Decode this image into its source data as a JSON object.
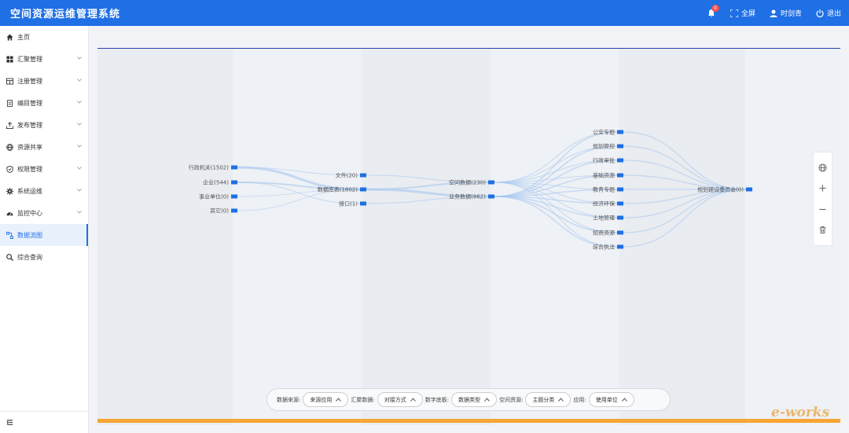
{
  "header": {
    "title": "空间资源运维管理系统",
    "notification_count": "0",
    "fullscreen_label": "全屏",
    "user_name": "时剑青",
    "logout_label": "退出"
  },
  "sidebar": {
    "items": [
      {
        "label": "主页",
        "icon": "home-icon",
        "has_chevron": false
      },
      {
        "label": "汇聚管理",
        "icon": "grid-icon",
        "has_chevron": true
      },
      {
        "label": "注册管理",
        "icon": "register-icon",
        "has_chevron": true
      },
      {
        "label": "编目管理",
        "icon": "catalog-icon",
        "has_chevron": true
      },
      {
        "label": "发布管理",
        "icon": "upload-icon",
        "has_chevron": true
      },
      {
        "label": "资源共享",
        "icon": "globe-icon",
        "has_chevron": true
      },
      {
        "label": "权限管理",
        "icon": "shield-icon",
        "has_chevron": true
      },
      {
        "label": "系统运维",
        "icon": "gear-icon",
        "has_chevron": true
      },
      {
        "label": "监控中心",
        "icon": "monitor-icon",
        "has_chevron": true
      },
      {
        "label": "数据流图",
        "icon": "flow-icon",
        "has_chevron": false,
        "active": true
      },
      {
        "label": "综合查询",
        "icon": "search-icon",
        "has_chevron": false
      }
    ],
    "collapse_icon": "menu-collapse-icon"
  },
  "flow": {
    "accent": "#1f6fe5",
    "link_color": "#a8c8f0",
    "columns": [
      {
        "nodes": [
          "行政机关(1502)",
          "企业(544)",
          "事业单位(0)",
          "其它(0)"
        ]
      },
      {
        "nodes": [
          "文件(20)",
          "数据库表(1802)",
          "接口(1)"
        ]
      },
      {
        "nodes": [
          "空间数据(230)",
          "业务数据(862)"
        ]
      },
      {
        "nodes": [
          "公安专题",
          "规划管控",
          "行政审批",
          "基础资源",
          "教育专题",
          "经济环保",
          "土地管理",
          "招商资源",
          "综合执法"
        ]
      },
      {
        "nodes": [
          "规划建设委员会(0)"
        ]
      }
    ]
  },
  "zoom": {
    "icons": [
      "globe-icon",
      "zoom-in-icon",
      "zoom-out-icon",
      "trash-icon"
    ]
  },
  "filters": [
    {
      "label": "数据来源:",
      "value": "来源应用"
    },
    {
      "label": "汇聚数据:",
      "value": "对接方式"
    },
    {
      "label": "数字底板:",
      "value": "数据类型"
    },
    {
      "label": "空间资源:",
      "value": "主题分类"
    },
    {
      "label": "应用:",
      "value": "使用单位"
    }
  ],
  "watermark": "e-works"
}
